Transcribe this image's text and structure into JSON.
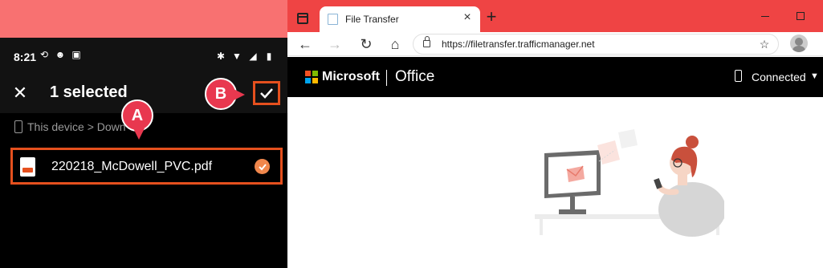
{
  "phone": {
    "status": {
      "time": "8:21"
    },
    "appbar": {
      "title": "1 selected"
    },
    "breadcrumb": {
      "text": "This device > Down"
    },
    "file": {
      "name": "220218_McDowell_PVC.pdf"
    },
    "markers": {
      "a": "A",
      "b": "B"
    }
  },
  "browser": {
    "tab": {
      "title": "File Transfer"
    },
    "address": {
      "url": "https://filetransfer.trafficmanager.net"
    },
    "header": {
      "brand": "Microsoft",
      "product": "Office",
      "status": "Connected"
    }
  },
  "colors": {
    "accent": "#e5501e",
    "marker": "#e8384f",
    "tabstrip": "#ef4444",
    "background": "#f87171"
  },
  "icons": [
    "close-icon",
    "check-icon",
    "pdf-file-icon",
    "phone-icon",
    "lock-icon",
    "back-icon",
    "forward-icon",
    "refresh-icon",
    "home-icon",
    "favorites-icon",
    "profile-icon",
    "microsoft-logo-icon"
  ]
}
